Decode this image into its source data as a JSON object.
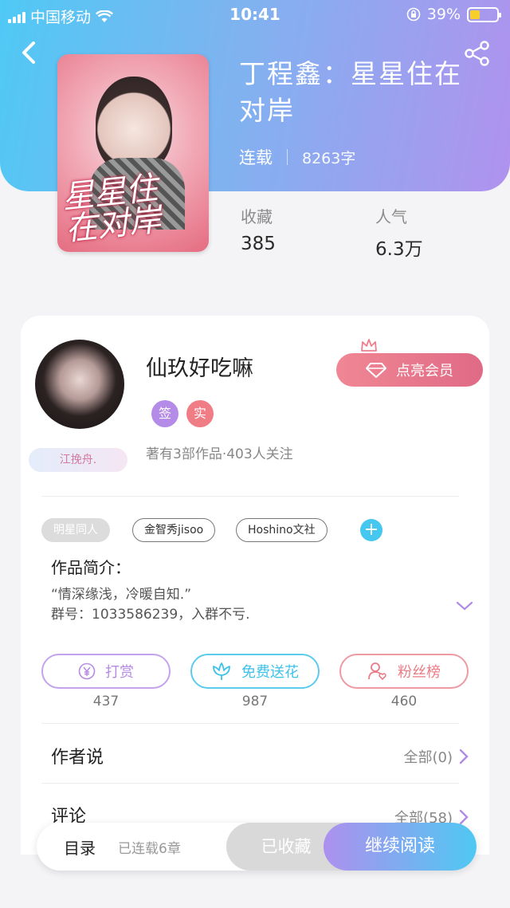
{
  "status_bar": {
    "carrier": "中国移动",
    "time": "10:41",
    "battery": "39%",
    "battery_level": 0.39
  },
  "book": {
    "title": "丁程鑫：星星住在对岸",
    "cover_text": "星星住在对岸",
    "status": "连载",
    "word_count": "8263字"
  },
  "stats": [
    {
      "label": "收藏",
      "value": "385"
    },
    {
      "label": "人气",
      "value": "6.3万"
    }
  ],
  "author": {
    "name": "仙玖好吃嘛",
    "badge": "江挽舟.",
    "tags": [
      {
        "text": "签",
        "color": "#b48be6"
      },
      {
        "text": "实",
        "color": "#f07c86"
      }
    ],
    "summary": "著有3部作品·403人关注",
    "vip_label": "点亮会员"
  },
  "tags": [
    "明星同人",
    "金智秀jisoo",
    "Hoshino文社"
  ],
  "intro": {
    "title": "作品简介：",
    "text": "“情深缘浅，冷暖自知.”\n群号：1033586239，入群不亏."
  },
  "actions": [
    {
      "label": "打赏",
      "count": "437",
      "color": "#b68ae6"
    },
    {
      "label": "免费送花",
      "count": "987",
      "color": "#3ec2ea"
    },
    {
      "label": "粉丝榜",
      "count": "460",
      "color": "#ea7c86"
    }
  ],
  "sections": [
    {
      "label": "作者说",
      "right": "全部(0)"
    },
    {
      "label": "评论",
      "right": "全部(58)"
    }
  ],
  "bottom_bar": {
    "catalog": "目录",
    "chapters": "已连载6章",
    "collected": "已收藏",
    "read": "继续阅读"
  }
}
